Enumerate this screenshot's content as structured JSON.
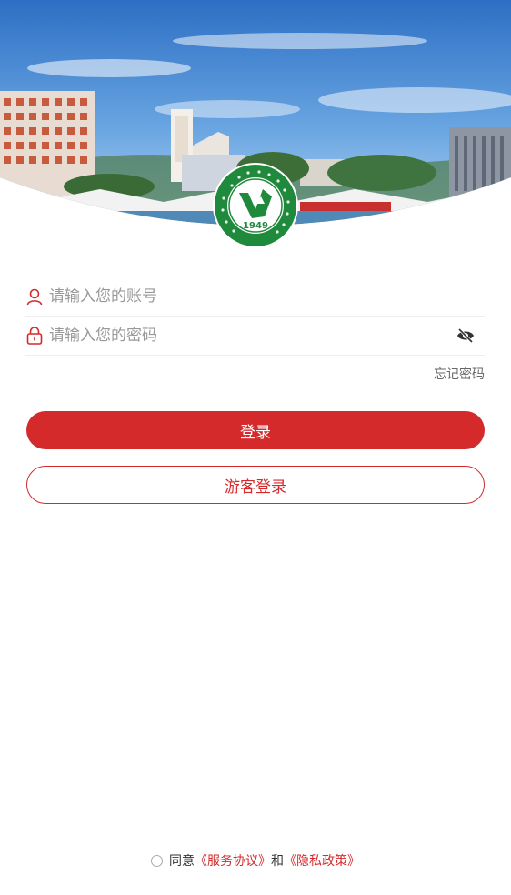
{
  "header": {
    "emblem_year": "1949",
    "emblem_ring_text": "湖北三峡职业技术学院 HUBEI THREE GORGES POLYTECHNIC"
  },
  "login_form": {
    "account_placeholder": "请输入您的账号",
    "password_placeholder": "请输入您的密码",
    "forgot_password": "忘记密码",
    "login_button": "登录",
    "guest_login_button": "游客登录"
  },
  "agreement": {
    "prefix": "同意",
    "service_agreement": "《服务协议》",
    "and": "和",
    "privacy_policy": "《隐私政策》"
  },
  "icons": {
    "account": "user-icon",
    "password": "lock-icon",
    "toggle_visibility": "eye-off-icon"
  },
  "colors": {
    "accent": "#d42a2c",
    "emblem_green": "#1f8a3c"
  }
}
